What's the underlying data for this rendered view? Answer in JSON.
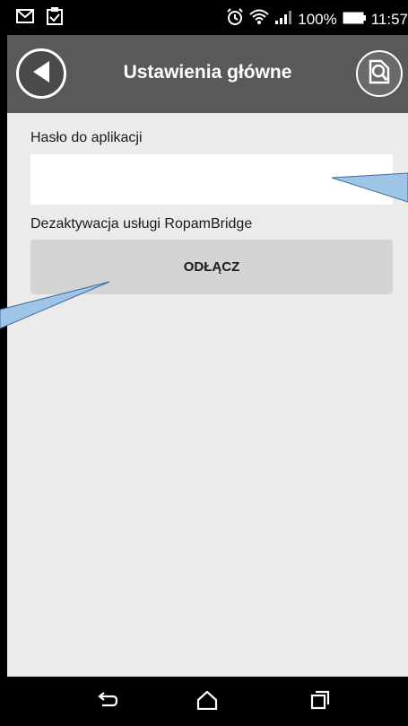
{
  "status_bar": {
    "battery": "100%",
    "time": "11:57",
    "icons": [
      "gmail-icon",
      "clipboard-check-icon",
      "alarm-icon",
      "wifi-icon",
      "signal-icon",
      "battery-icon"
    ]
  },
  "app_bar": {
    "title": "Ustawienia główne",
    "back_icon": "back-arrow-icon",
    "help_icon": "search-help-icon"
  },
  "form": {
    "password_label": "Hasło do aplikacji",
    "password_value": "",
    "deactivate_label": "Dezaktywacja usługi RopamBridge",
    "disconnect_label": "ODŁĄCZ"
  },
  "nav_bar": {
    "icons": [
      "back-icon",
      "home-icon",
      "recent-apps-icon"
    ]
  },
  "colors": {
    "app_bar": "#595959",
    "content_bg": "#ebebeb",
    "button_bg": "#d4d4d4",
    "callout": "#9ec4e6"
  }
}
